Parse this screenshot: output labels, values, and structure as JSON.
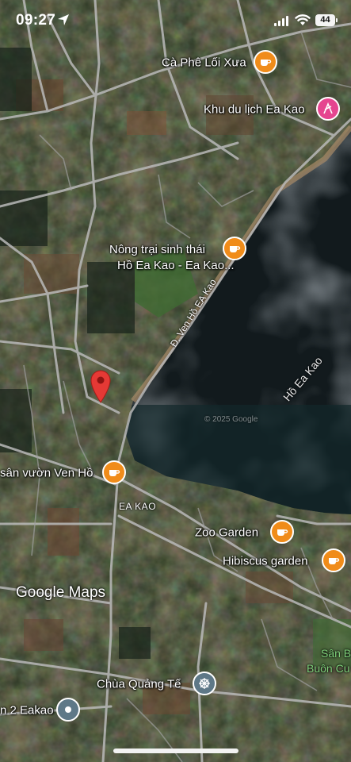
{
  "status_bar": {
    "time": "09:27",
    "battery": "44"
  },
  "pois": [
    {
      "name": "Cà Phê Lối Xưa",
      "category": "cafe",
      "icon": "coffee-icon",
      "color": "#f08c1a"
    },
    {
      "name": "Khu du lịch Ea Kao",
      "category": "tourist",
      "icon": "pin-flag-icon",
      "color": "#e5458f"
    },
    {
      "name": "Nông trại sinh thái",
      "name_line2": "Hồ Ea Kao - Ea Kao...",
      "category": "cafe",
      "icon": "coffee-icon",
      "color": "#f08c1a"
    },
    {
      "name": "sân vườn Ven Hồ",
      "category": "cafe",
      "icon": "coffee-icon",
      "color": "#f08c1a"
    },
    {
      "name": "Zoo Garden",
      "category": "cafe",
      "icon": "coffee-icon",
      "color": "#f08c1a"
    },
    {
      "name": "Hibiscus garden",
      "category": "cafe",
      "icon": "coffee-icon",
      "color": "#f08c1a"
    },
    {
      "name": "Chùa Quảng Tế",
      "category": "temple",
      "icon": "dharma-wheel-icon",
      "color": "#5e7887"
    },
    {
      "name": "n 2 Eakao",
      "category": "place",
      "icon": "place-dot-icon",
      "color": "#5e7887"
    }
  ],
  "map_labels": {
    "road": "Đ. Ven Hồ EA Kao",
    "lake": "Hồ Ea Kao",
    "area": "EA KAO",
    "edge_green_line1": "Sân B",
    "edge_green_line2": "Buôn Cu",
    "copyright": "© 2025 Google"
  },
  "branding": {
    "text": "Google Maps"
  },
  "selected_pin": {
    "icon": "red-pin-icon",
    "color": "#e53935"
  }
}
